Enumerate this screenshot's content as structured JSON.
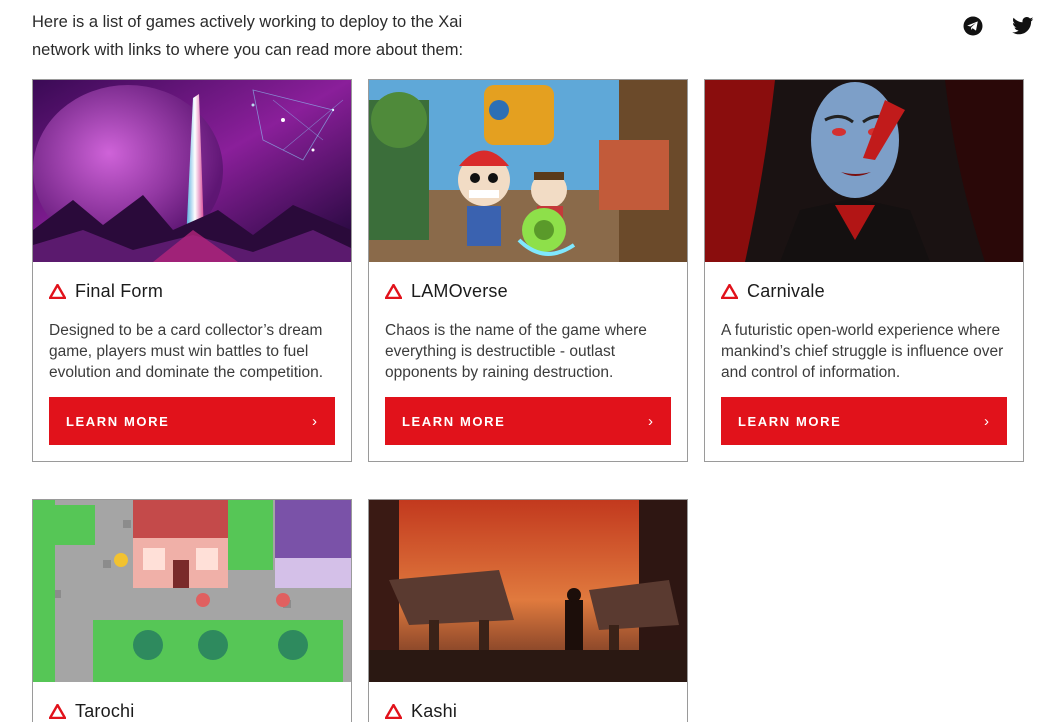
{
  "intro": "Here is a list of games actively working to deploy to the Xai network with links to where you can read more about them:",
  "social": [
    {
      "icon": "telegram-icon"
    },
    {
      "icon": "twitter-icon"
    }
  ],
  "accent": "#e1121b",
  "cards": [
    {
      "title": "Final Form",
      "desc": "Designed to be a card collector’s dream game, players must win battles to fuel evolution and dominate the competition.",
      "button": "LEARN MORE"
    },
    {
      "title": "LAMOverse",
      "desc": "Chaos is the name of the game where everything is destructible - outlast opponents by raining destruction.",
      "button": "LEARN MORE"
    },
    {
      "title": "Carnivale",
      "desc": "A futuristic open-world experience where mankind’s chief struggle is influence over and control of information.",
      "button": "LEARN MORE"
    },
    {
      "title": "Tarochi"
    },
    {
      "title": "Kashi"
    }
  ]
}
